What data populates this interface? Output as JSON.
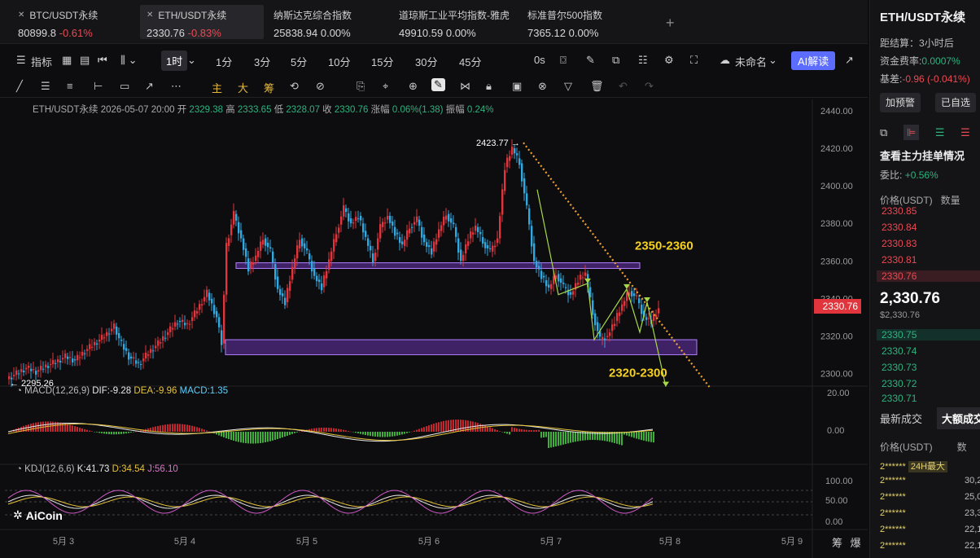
{
  "tickers": [
    {
      "name": "BTC/USDT永续",
      "price": "80899.8",
      "change": "-0.61%",
      "dir": "down"
    },
    {
      "name": "ETH/USDT永续",
      "price": "2330.76",
      "change": "-0.83%",
      "dir": "down"
    },
    {
      "name": "纳斯达克综合指数",
      "price": "25838.94",
      "change": "0.00%",
      "dir": "flat"
    },
    {
      "name": "道琼斯工业平均指数-雅虎",
      "price": "49910.59",
      "change": "0.00%",
      "dir": "flat"
    },
    {
      "name": "标准普尔500指数",
      "price": "7365.12",
      "change": "0.00%",
      "dir": "flat"
    }
  ],
  "toolbar": {
    "indicators": "指标",
    "timeframes": [
      "1时",
      "1分",
      "3分",
      "5分",
      "10分",
      "15分",
      "30分",
      "45分",
      "0s"
    ],
    "unnamed": "未命名",
    "ai": "AI解读"
  },
  "drawtools": {
    "main": "主",
    "big": "大",
    "chip": "筹"
  },
  "info": {
    "symbol": "ETH/USDT永续",
    "datetime": "2026-05-07 20:00",
    "open_l": "开",
    "open": "2329.38",
    "high_l": "高",
    "high": "2333.65",
    "low_l": "低",
    "low": "2328.07",
    "close_l": "收",
    "close": "2330.76",
    "chg_l": "涨幅",
    "chg": "0.06%(1.38)",
    "amp_l": "振幅",
    "amp": "0.24%"
  },
  "macd": {
    "label": "MACD(12,26,9)",
    "dif": "DIF:-9.28",
    "dea": "DEA:-9.96",
    "macd": "MACD:1.35"
  },
  "kdj": {
    "label": "KDJ(12,6,6)",
    "k": "K:41.73",
    "d": "D:34.54",
    "j": "J:56.10"
  },
  "annotations": {
    "high_mark": "2423.77 →",
    "low_mark": "← 2295.26",
    "resistance": "2350-2360",
    "target": "2320-2300"
  },
  "last_price_tag": "2330.76",
  "logo": "AiCoin",
  "axis_buttons": [
    "筹",
    "爆"
  ],
  "chart_data": {
    "type": "candlestick",
    "y_ticks": [
      "2440.00",
      "2420.00",
      "2400.00",
      "2380.00",
      "2360.00",
      "2340.00",
      "2320.00",
      "2300.00"
    ],
    "ylim": [
      2290,
      2445
    ],
    "macd_ticks": [
      "20.00",
      "0.00"
    ],
    "kdj_ticks": [
      "100.00",
      "50.00",
      "0.00"
    ],
    "x_ticks": [
      "5月 3",
      "5月 4",
      "5月 5",
      "5月 6",
      "5月 7",
      "5月 8",
      "5月 9"
    ],
    "zones": [
      {
        "from": 2356,
        "to": 2359
      },
      {
        "from": 2310,
        "to": 2318
      }
    ],
    "colors": {
      "up": "#e0353c",
      "down": "#31a8e0",
      "zone": "#7a3ccf",
      "trend": "#f0a030",
      "arrow": "#a8d84a"
    }
  },
  "rpanel": {
    "title": "ETH/USDT永续",
    "settle": "距结算：",
    "settle_v": "3小时后",
    "funding": "资金费率:",
    "funding_v": "0.0007%",
    "basis": "基差:",
    "basis_v": "-0.96 (-0.041%)",
    "btn_alert": "加预警",
    "btn_watch": "已自选",
    "orders_title": "查看主力挂单情况",
    "ratio_l": "委比:",
    "ratio_v": "+0.56%",
    "col_price": "价格(USDT)",
    "col_qty": "数量",
    "asks": [
      "2330.85",
      "2330.84",
      "2330.83",
      "2330.81",
      "2330.76"
    ],
    "last": "2,330.76",
    "last_usd": "$2,330.76",
    "bids": [
      "2330.75",
      "2330.74",
      "2330.73",
      "2330.72",
      "2330.71"
    ],
    "tab_latest": "最新成交",
    "tab_big": "大额成交",
    "trade_col_price": "价格(USDT)",
    "trade_col_qty": "数",
    "trades": [
      {
        "price": "2******",
        "tag": "24H最大",
        "qty": ""
      },
      {
        "price": "2******",
        "qty": "30,2"
      },
      {
        "price": "2******",
        "qty": "25,0"
      },
      {
        "price": "2******",
        "qty": "23,3"
      },
      {
        "price": "2******",
        "qty": "22,1"
      },
      {
        "price": "2******",
        "qty": "22,1"
      }
    ]
  }
}
